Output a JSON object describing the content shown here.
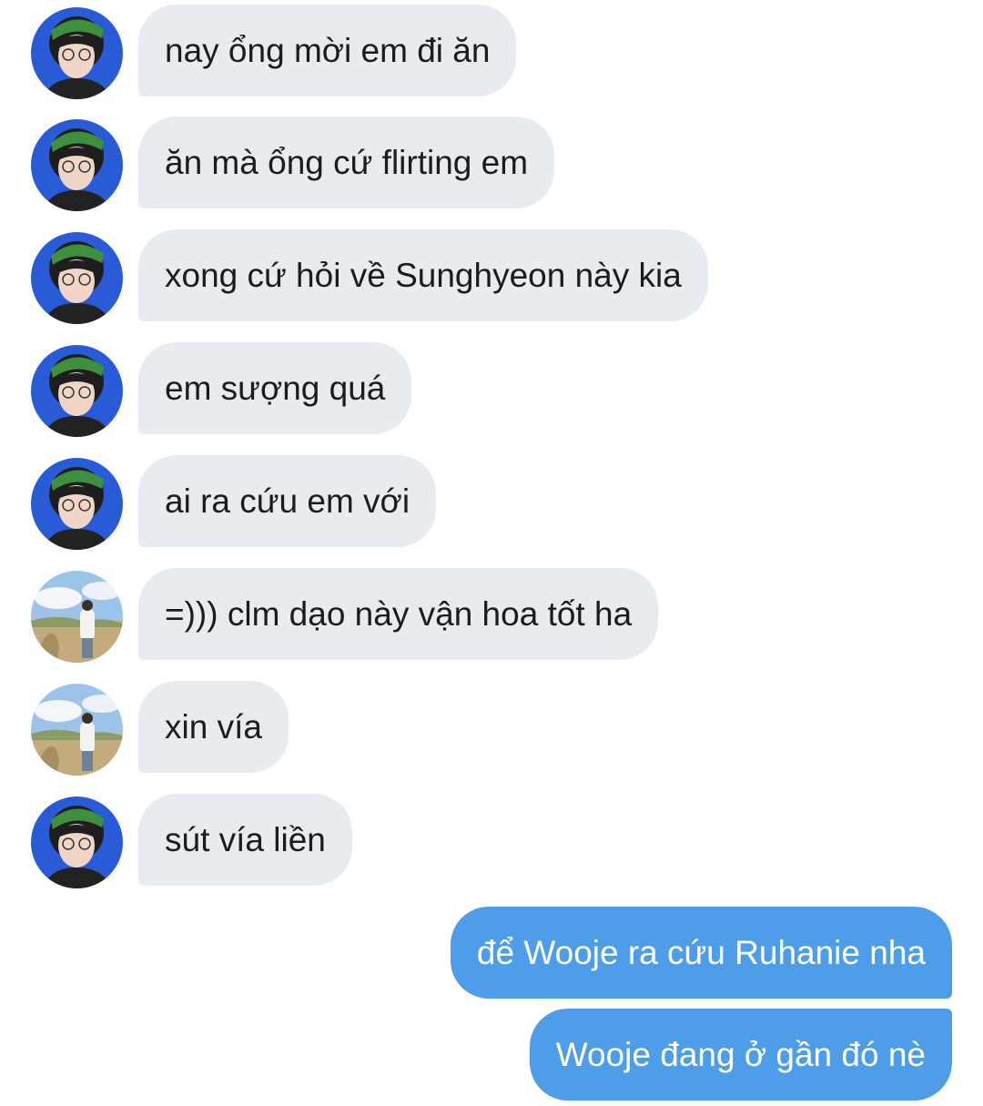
{
  "conversation": {
    "messages": [
      {
        "sender": "contact-a",
        "text": "nay ổng mời em đi ăn"
      },
      {
        "sender": "contact-a",
        "text": "ăn mà ổng cứ flirting em"
      },
      {
        "sender": "contact-a",
        "text": "xong cứ hỏi về Sunghyeon này kia"
      },
      {
        "sender": "contact-a",
        "text": "em sượng quá"
      },
      {
        "sender": "contact-a",
        "text": "ai ra cứu em với"
      },
      {
        "sender": "contact-b",
        "text": "=))) clm dạo này vận hoa tốt ha"
      },
      {
        "sender": "contact-b",
        "text": "xin vía"
      },
      {
        "sender": "contact-a",
        "text": "sút vía liền"
      },
      {
        "sender": "me",
        "text": "để Wooje ra cứu Ruhanie nha"
      },
      {
        "sender": "me",
        "text": "Wooje đang ở gần đó nè"
      }
    ]
  },
  "colors": {
    "incoming_bubble": "#e8ebf0",
    "outgoing_bubble": "#4e9de9",
    "incoming_text": "#1c1c1c",
    "outgoing_text": "#ffffff"
  },
  "avatars": {
    "contact-a": "person-avatar-blue-background",
    "contact-b": "person-avatar-field-sky"
  }
}
